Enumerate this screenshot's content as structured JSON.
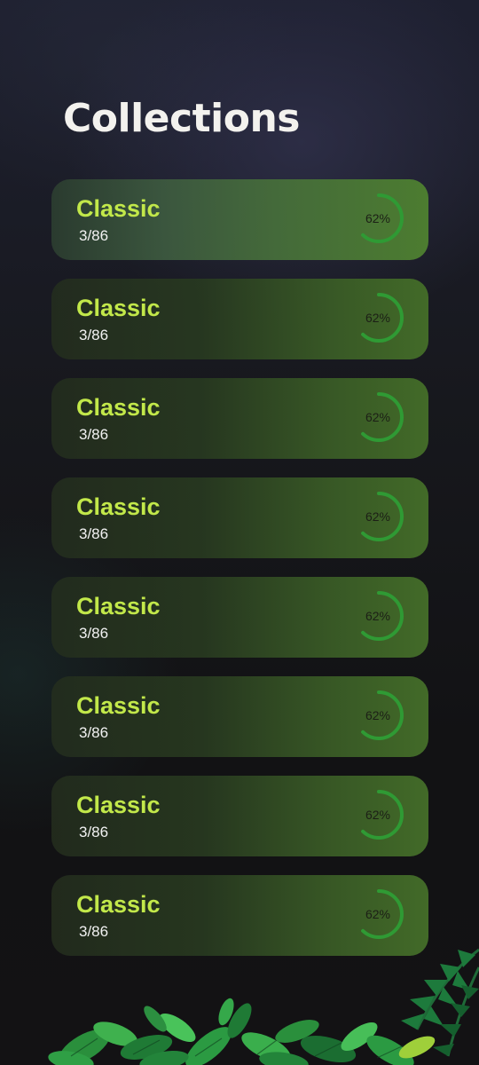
{
  "page": {
    "title": "Collections"
  },
  "collections": [
    {
      "name": "Classic",
      "count": "3/86",
      "progress_label": "62%",
      "progress": 0.62
    },
    {
      "name": "Classic",
      "count": "3/86",
      "progress_label": "62%",
      "progress": 0.62
    },
    {
      "name": "Classic",
      "count": "3/86",
      "progress_label": "62%",
      "progress": 0.62
    },
    {
      "name": "Classic",
      "count": "3/86",
      "progress_label": "62%",
      "progress": 0.62
    },
    {
      "name": "Classic",
      "count": "3/86",
      "progress_label": "62%",
      "progress": 0.62
    },
    {
      "name": "Classic",
      "count": "3/86",
      "progress_label": "62%",
      "progress": 0.62
    },
    {
      "name": "Classic",
      "count": "3/86",
      "progress_label": "62%",
      "progress": 0.62
    },
    {
      "name": "Classic",
      "count": "3/86",
      "progress_label": "62%",
      "progress": 0.62
    }
  ],
  "colors": {
    "title_text": "#f3f2ee",
    "card_title": "#c2e84a",
    "progress_ring": "#2f9a34"
  },
  "icons": {
    "decoration": "jungle-foliage"
  }
}
